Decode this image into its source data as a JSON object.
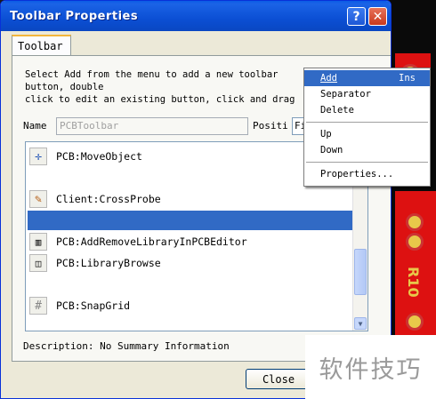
{
  "window": {
    "title": "Toolbar Properties",
    "help_glyph": "?",
    "close_glyph": "✕"
  },
  "tabs": [
    {
      "label": "Toolbar"
    }
  ],
  "instructions": {
    "line1": "Select Add from the menu to add a new toolbar",
    "line2": "button, double",
    "line3": "click to edit an existing button, click and drag"
  },
  "name_field": {
    "label": "Name",
    "value": "PCBToolbar"
  },
  "position_field": {
    "label": "Positi",
    "value": "Fi"
  },
  "toolbar_items": [
    {
      "icon": "move-object-icon",
      "glyph": "✛",
      "label": "PCB:MoveObject"
    },
    {
      "icon": "cross-probe-icon",
      "glyph": "✎",
      "label": "Client:CrossProbe"
    },
    {
      "icon": "",
      "glyph": "",
      "label": "",
      "selected": true
    },
    {
      "icon": "add-remove-library-icon",
      "glyph": "📖",
      "label": "PCB:AddRemoveLibraryInPCBEditor"
    },
    {
      "icon": "library-browse-icon",
      "glyph": "🔍",
      "label": "PCB:LibraryBrowse"
    },
    {
      "icon": "snap-grid-icon",
      "glyph": "#",
      "label": "PCB:SnapGrid"
    }
  ],
  "description": "Description: No Summary Information",
  "close_button": "Close",
  "context_menu": {
    "items": [
      {
        "label": "Add",
        "shortcut": "Ins",
        "highlighted": true
      },
      {
        "label": "Separator",
        "shortcut": ""
      },
      {
        "label": "Delete",
        "shortcut": ""
      },
      {
        "label": "Up",
        "shortcut": ""
      },
      {
        "label": "Down",
        "shortcut": ""
      },
      {
        "label": "Properties...",
        "shortcut": ""
      }
    ]
  },
  "pcb_label": "R10",
  "watermark": "软件技巧",
  "colors": {
    "title_bar": "#0b4fd4",
    "selection": "#316ac5",
    "dialog_bg": "#ece9d8"
  }
}
